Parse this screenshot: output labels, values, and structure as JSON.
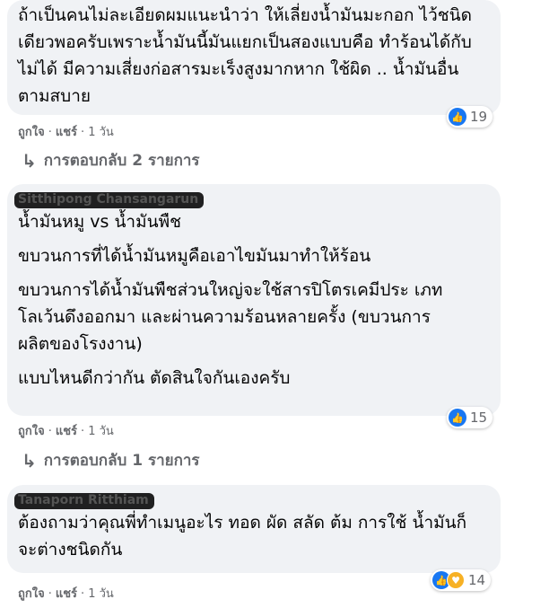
{
  "comments": [
    {
      "lines": [
        "ถ้าเป็นคนไม่ละเอียดผมแนะนำว่า ให้เลี่ยงน้ำมันมะกอก ไว้ชนิดเดียวพอครับเพราะน้ำมันนี้มันแยกเป็นสองแบบคือ ทำร้อนได้กับไม่ได้ มีความเสี่ยงก่อสารมะเร็งสูงมากหาก ใช้ผิด .. น้ำมันอื่นตามสบาย"
      ],
      "like_label": "ถูกใจ",
      "share_label": "แชร์",
      "time": "1 วัน",
      "reaction_count": "19",
      "replies_label": "การตอบกลับ 2 รายการ"
    },
    {
      "author": "Sitthipong Chansangarun",
      "lines": [
        "น้ำมันหมู vs น้ำมันพืช",
        "ขบวนการที่ได้น้ำมันหมูคือเอาไขมันมาทำให้ร้อน",
        "ขบวนการได้น้ำมันพืชส่วนใหญ่จะใช้สารปิโตรเคมีประ เภทโลเว้นดึงออกมา และผ่านความร้อนหลายครั้ง (ขบวนการผลิตของโรงงาน)",
        "แบบไหนดีกว่ากัน ตัดสินใจกันเองครับ"
      ],
      "like_label": "ถูกใจ",
      "share_label": "แชร์",
      "time": "1 วัน",
      "reaction_count": "15",
      "replies_label": "การตอบกลับ 1 รายการ"
    },
    {
      "author": "Tanaporn Ritthiam",
      "lines": [
        "ต้องถามว่าคุณพี่ทำเมนูอะไร ทอด ผัด สลัด ต้ม การใช้ น้ำมันก็จะต่างชนิดกัน"
      ],
      "like_label": "ถูกใจ",
      "share_label": "แชร์",
      "time": "1 วัน",
      "reaction_count": "14"
    }
  ],
  "icons": {
    "like": "thumbs-up-icon",
    "care": "care-icon",
    "reply_arrow": "reply-arrow-icon"
  },
  "colors": {
    "bubble": "#f0f2f5",
    "like_blue": "#1877f2",
    "care_yellow": "#f7b125",
    "meta_gray": "#65676b"
  }
}
